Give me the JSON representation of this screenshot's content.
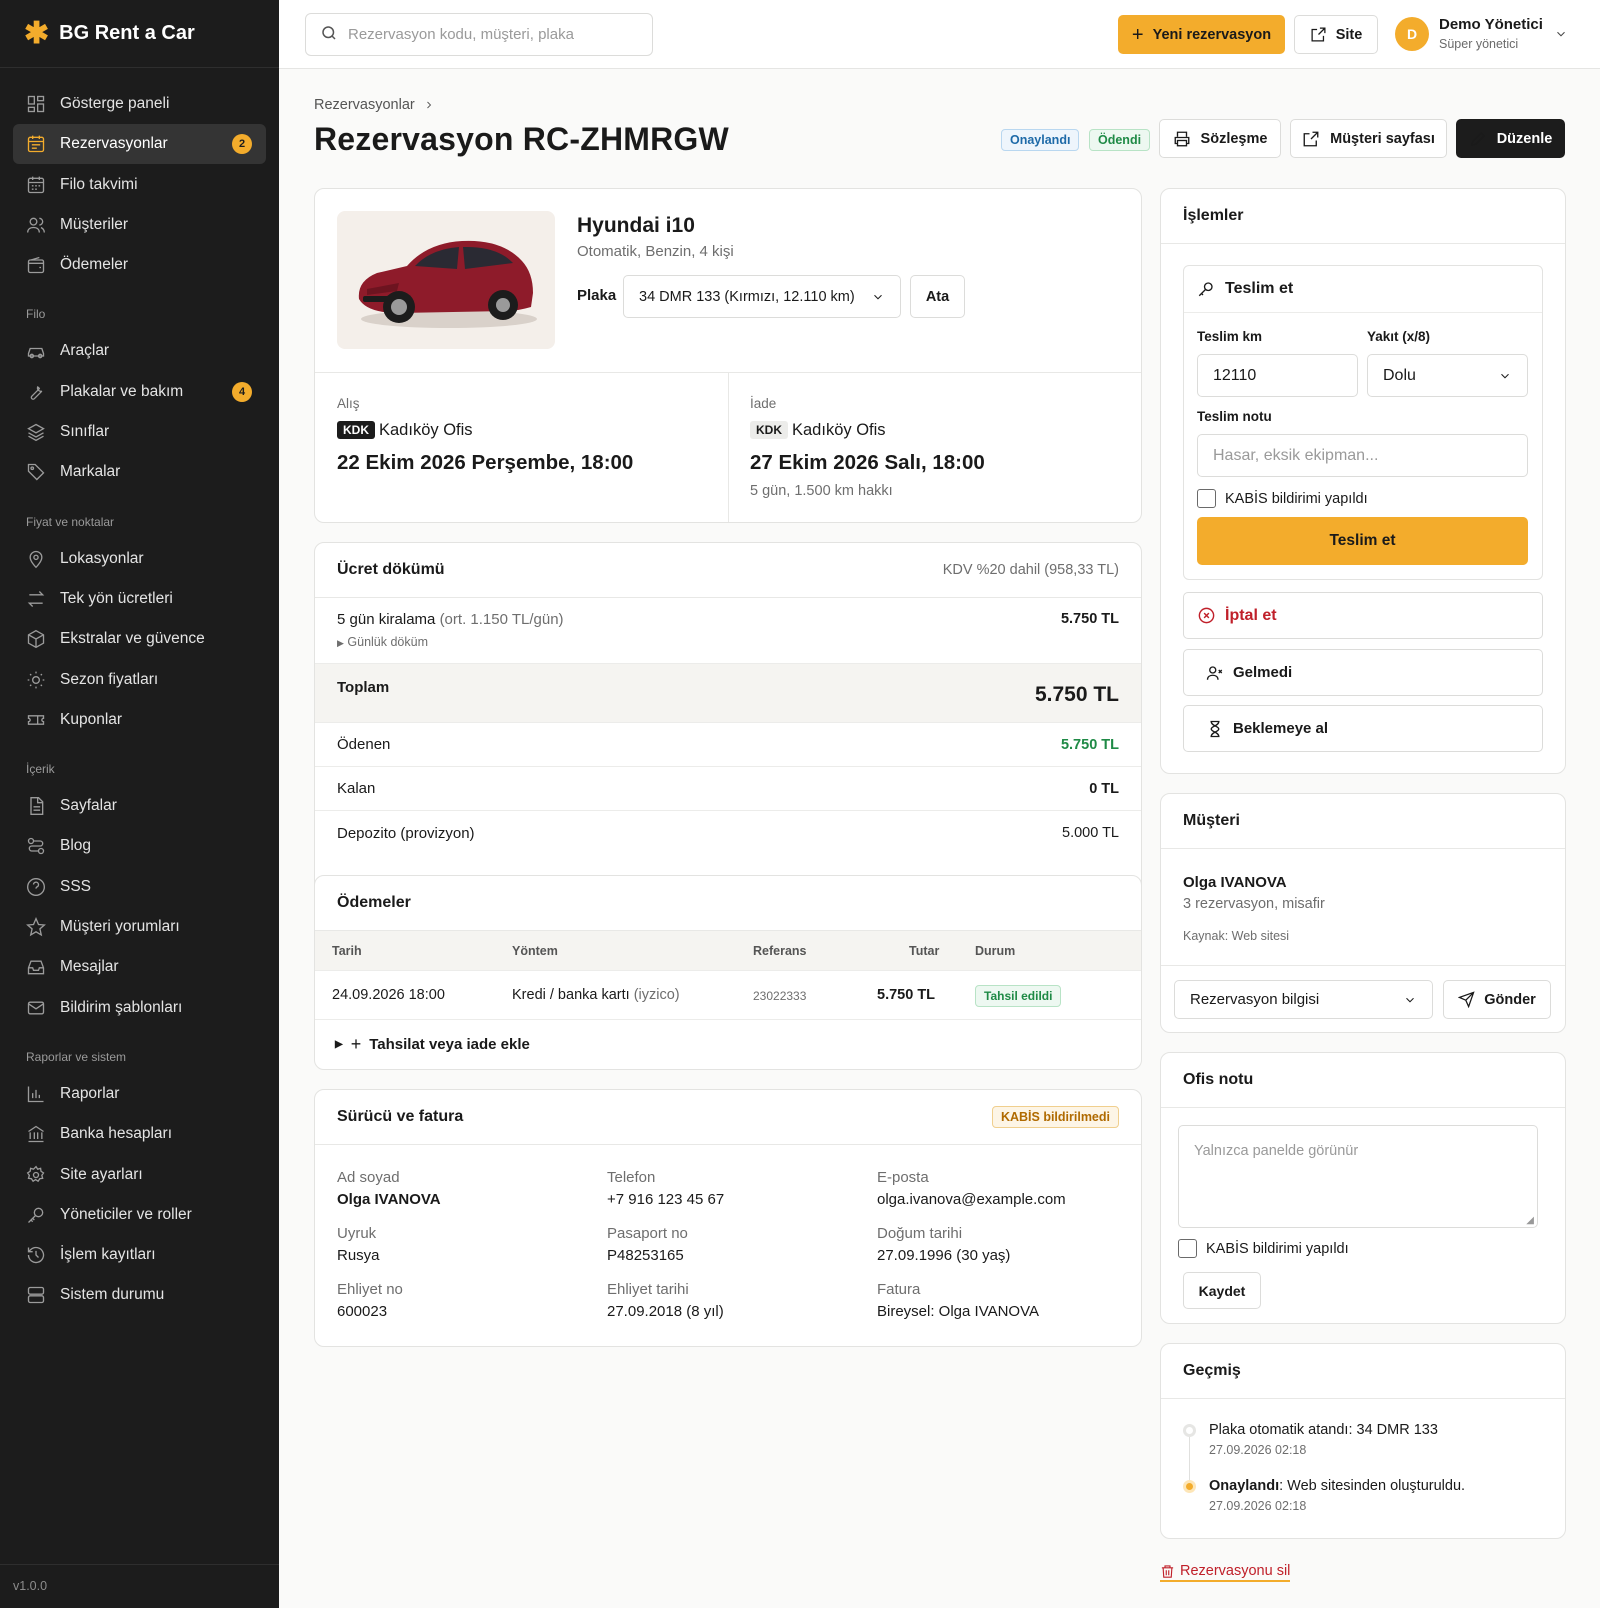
{
  "brand": {
    "name": "BG Rent a Car"
  },
  "sidebar": {
    "items": [
      {
        "label": "Gösterge paneli"
      },
      {
        "label": "Rezervasyonlar",
        "badge": "2"
      },
      {
        "label": "Filo takvimi"
      },
      {
        "label": "Müşteriler"
      },
      {
        "label": "Ödemeler"
      }
    ],
    "section_filo": "Filo",
    "filo_items": [
      {
        "label": "Araçlar"
      },
      {
        "label": "Plakalar ve bakım",
        "badge": "4"
      },
      {
        "label": "Sınıflar"
      },
      {
        "label": "Markalar"
      }
    ],
    "section_fiyat": "Fiyat ve noktalar",
    "fiyat_items": [
      {
        "label": "Lokasyonlar"
      },
      {
        "label": "Tek yön ücretleri"
      },
      {
        "label": "Ekstralar ve güvence"
      },
      {
        "label": "Sezon fiyatları"
      },
      {
        "label": "Kuponlar"
      }
    ],
    "section_icerik": "İçerik",
    "icerik_items": [
      {
        "label": "Sayfalar"
      },
      {
        "label": "Blog"
      },
      {
        "label": "SSS"
      },
      {
        "label": "Müşteri yorumları"
      },
      {
        "label": "Mesajlar"
      },
      {
        "label": "Bildirim şablonları"
      }
    ],
    "section_rapor": "Raporlar ve sistem",
    "rapor_items": [
      {
        "label": "Raporlar"
      },
      {
        "label": "Banka hesapları"
      },
      {
        "label": "Site ayarları"
      },
      {
        "label": "Yöneticiler ve roller"
      },
      {
        "label": "İşlem kayıtları"
      },
      {
        "label": "Sistem durumu"
      }
    ],
    "version": "v1.0.0"
  },
  "topbar": {
    "search_placeholder": "Rezervasyon kodu, müşteri, plaka",
    "new_button": "Yeni rezervasyon",
    "site_button": "Site",
    "user_initial": "D",
    "user_name": "Demo Yönetici",
    "user_role": "Süper yönetici"
  },
  "page": {
    "breadcrumb": "Rezervasyonlar",
    "title": "Rezervasyon RC-ZHMRGW",
    "status_confirmed": "Onaylandı",
    "status_paid": "Ödendi",
    "btn_contract": "Sözleşme",
    "btn_customer_page": "Müşteri sayfası",
    "btn_edit": "Düzenle"
  },
  "vehicle": {
    "name": "Hyundai i10",
    "specs": "Otomatik, Benzin, 4 kişi",
    "plate_label": "Plaka",
    "plate_value": "34 DMR 133 (Kırmızı, 12.110 km)",
    "assign_button": "Ata",
    "pickup_label": "Alış",
    "pickup_code": "KDK",
    "pickup_office": "Kadıköy Ofis",
    "pickup_date": "22 Ekim 2026 Perşembe, 18:00",
    "return_label": "İade",
    "return_code": "KDK",
    "return_office": "Kadıköy Ofis",
    "return_date": "27 Ekim 2026 Salı, 18:00",
    "duration": "5 gün, 1.500 km hakkı"
  },
  "fees": {
    "title": "Ücret dökümü",
    "vat_note": "KDV %20 dahil (958,33 TL)",
    "rental_label": "5 gün kiralama",
    "rental_avg": "(ort. 1.150 TL/gün)",
    "rental_amount": "5.750 TL",
    "daily_toggle": "Günlük döküm",
    "total_label": "Toplam",
    "total_amount": "5.750 TL",
    "paid_label": "Ödenen",
    "paid_amount": "5.750 TL",
    "remaining_label": "Kalan",
    "remaining_amount": "0 TL",
    "deposit_label": "Depozito (provizyon)",
    "deposit_amount": "5.000 TL",
    "paid_color": "#1f8a46"
  },
  "payments": {
    "title": "Ödemeler",
    "columns": [
      "Tarih",
      "Yöntem",
      "Referans",
      "Tutar",
      "Durum"
    ],
    "rows": [
      {
        "date": "24.09.2026 18:00",
        "method": "Kredi / banka kartı",
        "provider": "(iyzico)",
        "reference": "23022333",
        "amount": "5.750 TL",
        "status": "Tahsil edildi"
      }
    ],
    "add_label": "Tahsilat veya iade ekle"
  },
  "driver": {
    "title": "Sürücü ve fatura",
    "kabis_badge": "KABİS bildirilmedi",
    "fields": [
      {
        "label": "Ad soyad",
        "value": "Olga IVANOVA"
      },
      {
        "label": "Telefon",
        "value": "+7 916 123 45 67"
      },
      {
        "label": "E-posta",
        "value": "olga.ivanova@example.com"
      },
      {
        "label": "Uyruk",
        "value": "Rusya"
      },
      {
        "label": "Pasaport no",
        "value": "P48253165"
      },
      {
        "label": "Doğum tarihi",
        "value": "27.09.1996 (30 yaş)"
      },
      {
        "label": "Ehliyet no",
        "value": "600023"
      },
      {
        "label": "Ehliyet tarihi",
        "value": "27.09.2018 (8 yıl)"
      },
      {
        "label": "Fatura",
        "value": "Bireysel: Olga IVANOVA"
      }
    ]
  },
  "actions": {
    "title": "İşlemler",
    "deliver_title": "Teslim et",
    "km_label": "Teslim km",
    "km_value": "12110",
    "fuel_label": "Yakıt (x/8)",
    "fuel_value": "Dolu",
    "note_label": "Teslim notu",
    "note_placeholder": "Hasar, eksik ekipman...",
    "kabis_check": "KABİS bildirimi yapıldı",
    "deliver_button": "Teslim et",
    "cancel": "İptal et",
    "noshow": "Gelmedi",
    "hold": "Beklemeye al"
  },
  "customer": {
    "title": "Müşteri",
    "name": "Olga IVANOVA",
    "summary": "3 rezervasyon, misafir",
    "source": "Kaynak: Web sitesi",
    "template_value": "Rezervasyon bilgisi",
    "send_button": "Gönder"
  },
  "office_note": {
    "title": "Ofis notu",
    "placeholder": "Yalnızca panelde görünür",
    "kabis_check": "KABİS bildirimi yapıldı",
    "save_button": "Kaydet"
  },
  "history": {
    "title": "Geçmiş",
    "entries": [
      {
        "text": "Plaka otomatik atandı: 34 DMR 133",
        "bold": "",
        "time": "27.09.2026 02:18"
      },
      {
        "text": ": Web sitesinden oluşturuldu.",
        "bold": "Onaylandı",
        "time": "27.09.2026 02:18"
      }
    ]
  },
  "delete_link": "Rezervasyonu sil",
  "colors": {
    "accent": "#f3ac2c",
    "sidebar": "#1c1c1c",
    "danger": "#c0202a",
    "success": "#1f8a46"
  }
}
